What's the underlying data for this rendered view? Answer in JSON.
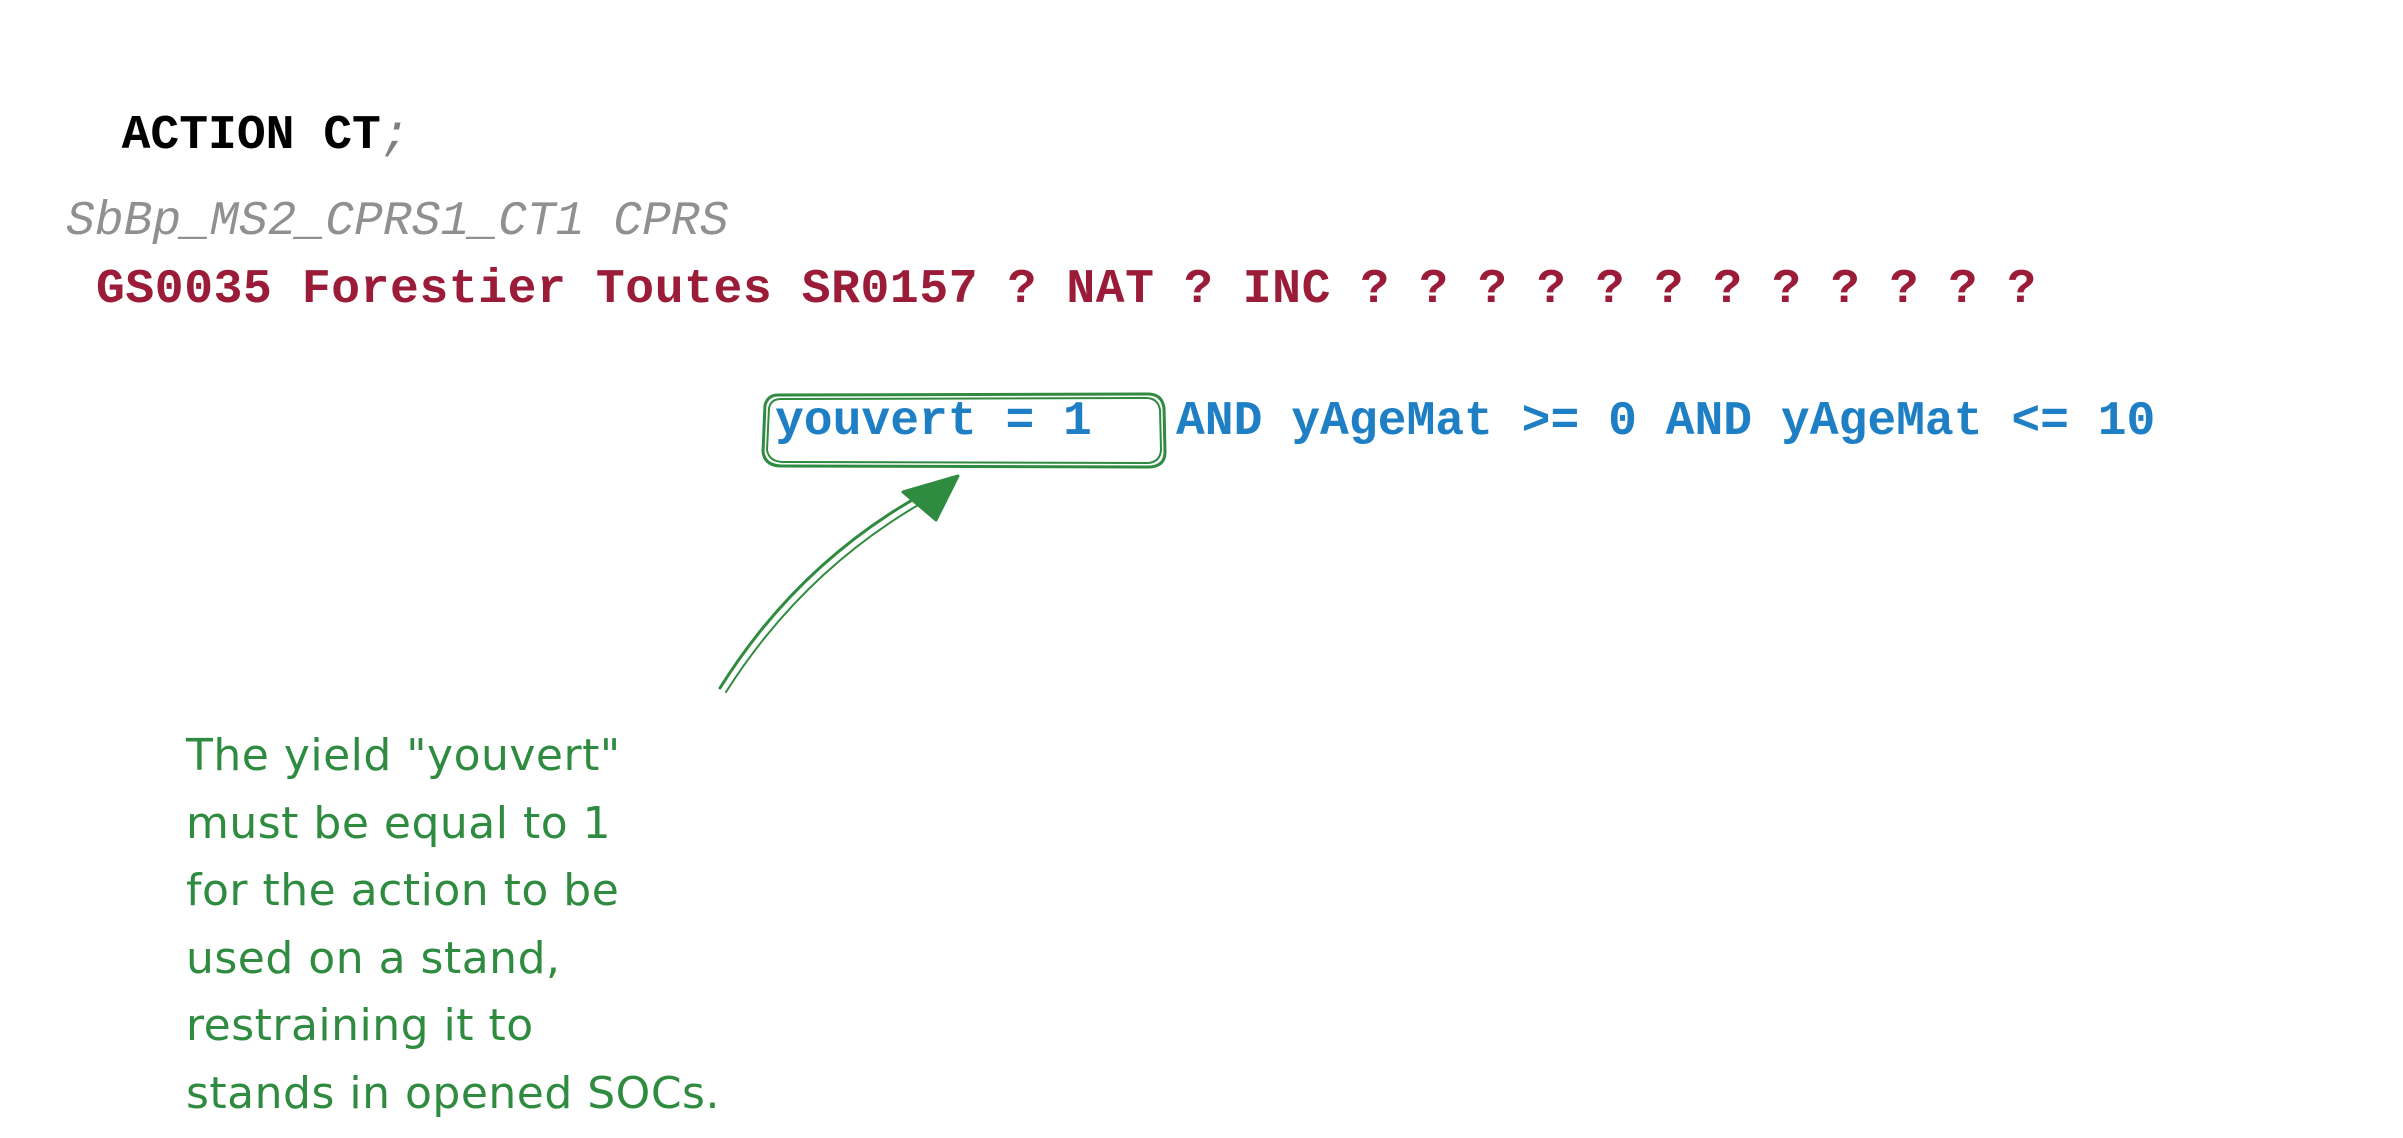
{
  "action_line": {
    "keyword": "ACTION CT",
    "terminator": ";"
  },
  "comment_line": "SbBp_MS2_CPRS1_CT1 CPRS",
  "level_line": "GS0035 Forestier Toutes SR0157 ? NAT ? INC ? ? ? ? ? ? ? ? ? ? ? ?",
  "condition": {
    "highlighted": "youvert = 1",
    "rest": "AND yAgeMat >= 0 AND yAgeMat <= 10"
  },
  "annotation": {
    "lines": [
      "The yield \"youvert\"",
      "must be equal to 1",
      "for the action to be",
      "used on a stand,",
      "restraining it to",
      "stands in opened SOCs."
    ],
    "color": "#2e8b3f"
  },
  "colors": {
    "keyword": "#000000",
    "comment": "#909090",
    "level": "#9b1c38",
    "condition": "#1f7fc4",
    "highlight": "#2e8b3f"
  }
}
